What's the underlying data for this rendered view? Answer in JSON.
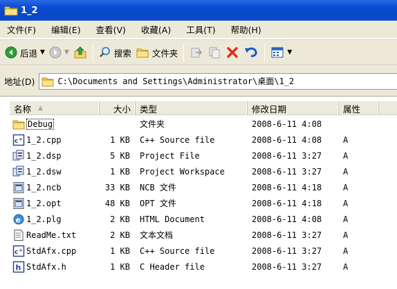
{
  "window": {
    "title": "1_2"
  },
  "menu": [
    "文件(F)",
    "编辑(E)",
    "查看(V)",
    "收藏(A)",
    "工具(T)",
    "帮助(H)"
  ],
  "toolbar": {
    "back_label": "后退",
    "search_label": "搜索",
    "folders_label": "文件夹"
  },
  "address": {
    "label": "地址(D)",
    "path": "C:\\Documents and Settings\\Administrator\\桌面\\1_2"
  },
  "columns": {
    "name": "名称",
    "size": "大小",
    "type": "类型",
    "modified": "修改日期",
    "attributes": "属性"
  },
  "files": [
    {
      "name": "Debug",
      "size": "",
      "type": "文件夹",
      "modified": "2008-6-11 4:08",
      "attr": "",
      "icon": "folder-icon"
    },
    {
      "name": "1_2.cpp",
      "size": "1 KB",
      "type": "C++ Source file",
      "modified": "2008-6-11 4:08",
      "attr": "A",
      "icon": "cpp-file-icon"
    },
    {
      "name": "1_2.dsp",
      "size": "5 KB",
      "type": "Project File",
      "modified": "2008-6-11 3:27",
      "attr": "A",
      "icon": "project-file-icon"
    },
    {
      "name": "1_2.dsw",
      "size": "1 KB",
      "type": "Project Workspace",
      "modified": "2008-6-11 3:27",
      "attr": "A",
      "icon": "workspace-file-icon"
    },
    {
      "name": "1_2.ncb",
      "size": "33 KB",
      "type": "NCB 文件",
      "modified": "2008-6-11 4:18",
      "attr": "A",
      "icon": "generic-file-icon"
    },
    {
      "name": "1_2.opt",
      "size": "48 KB",
      "type": "OPT 文件",
      "modified": "2008-6-11 4:18",
      "attr": "A",
      "icon": "generic-file-icon"
    },
    {
      "name": "1_2.plg",
      "size": "2 KB",
      "type": "HTML Document",
      "modified": "2008-6-11 4:08",
      "attr": "A",
      "icon": "html-file-icon"
    },
    {
      "name": "ReadMe.txt",
      "size": "2 KB",
      "type": "文本文档",
      "modified": "2008-6-11 3:27",
      "attr": "A",
      "icon": "text-file-icon"
    },
    {
      "name": "StdAfx.cpp",
      "size": "1 KB",
      "type": "C++ Source file",
      "modified": "2008-6-11 3:27",
      "attr": "A",
      "icon": "cpp-file-icon"
    },
    {
      "name": "StdAfx.h",
      "size": "1 KB",
      "type": "C Header file",
      "modified": "2008-6-11 3:27",
      "attr": "A",
      "icon": "header-file-icon"
    }
  ],
  "colors": {
    "titlebar": "#0b4fd6",
    "chrome": "#ece9d8",
    "delete": "#e8261f"
  }
}
